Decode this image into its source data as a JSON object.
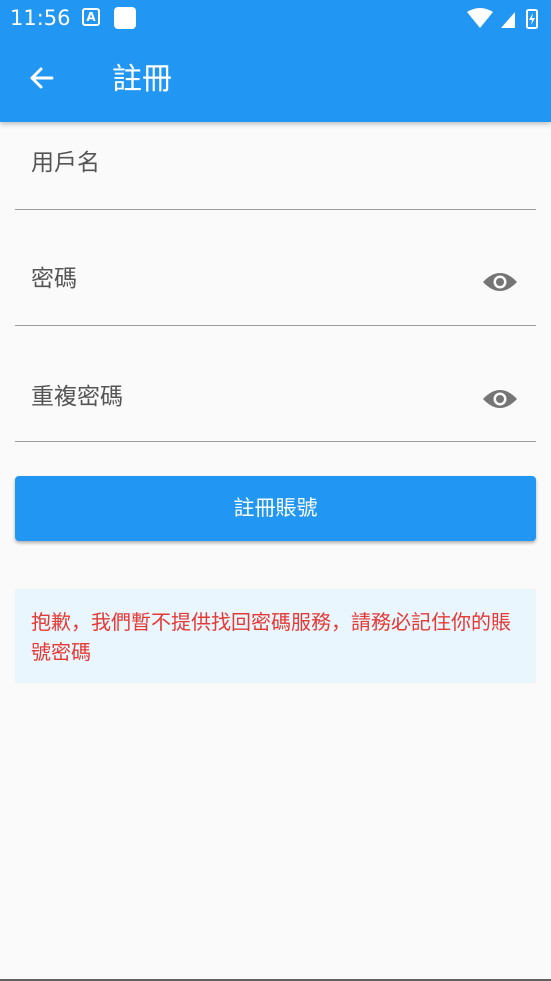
{
  "status_bar": {
    "time": "11:56",
    "app_icon_letter": "A"
  },
  "toolbar": {
    "title": "註冊"
  },
  "form": {
    "username_label": "用戶名",
    "password_label": "密碼",
    "confirm_password_label": "重複密碼",
    "register_button_label": "註冊賬號"
  },
  "notice": {
    "text": "抱歉，我們暫不提供找回密碼服務，請務必記住你的賬號密碼"
  },
  "colors": {
    "primary": "#2196f3",
    "notice_text": "#e53935",
    "notice_background": "#eaf6fd"
  }
}
